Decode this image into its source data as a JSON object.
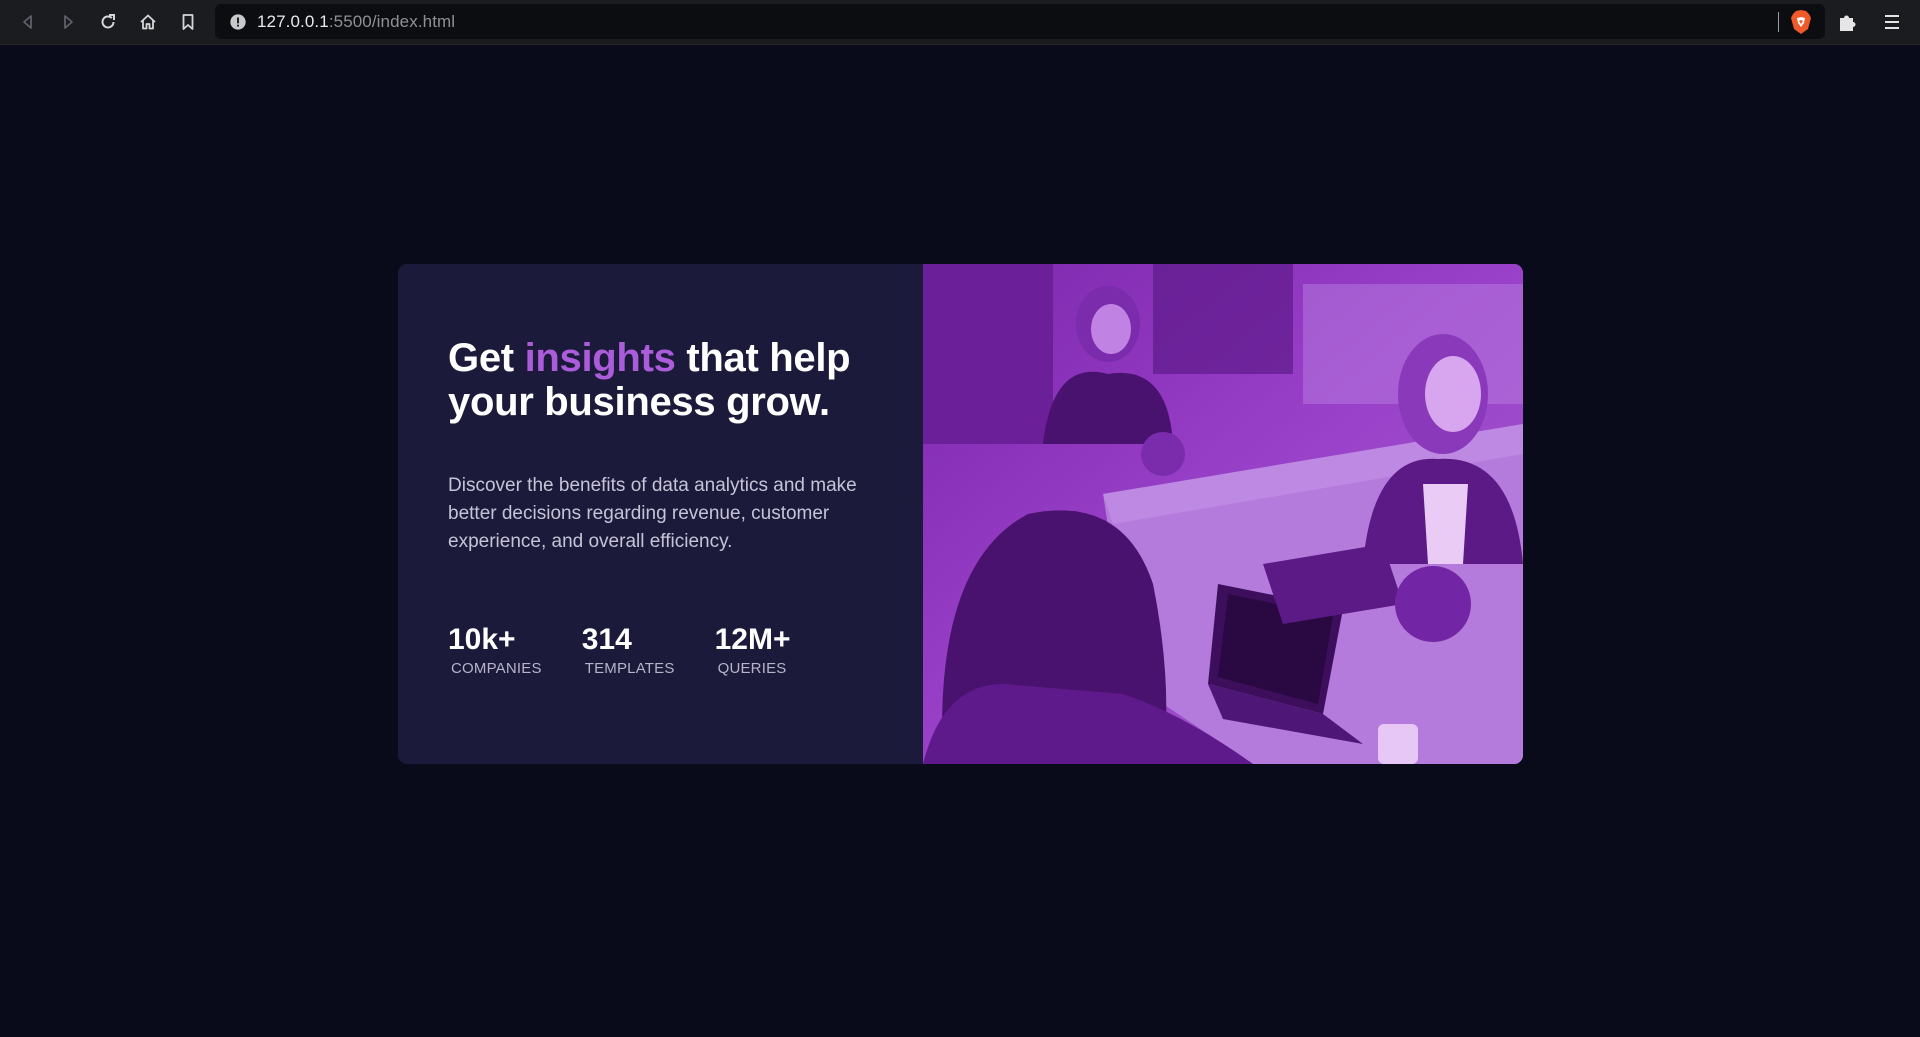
{
  "browser": {
    "url_host": "127.0.0.1",
    "url_path": ":5500/index.html"
  },
  "card": {
    "headline_part1": "Get ",
    "headline_accent": "insights",
    "headline_part2": " that help your business grow.",
    "description": "Discover the benefits of data analytics and make better decisions regarding revenue, customer experience, and overall efficiency.",
    "stats": [
      {
        "value": "10k+",
        "label": "COMPANIES"
      },
      {
        "value": "314",
        "label": "TEMPLATES"
      },
      {
        "value": "12M+",
        "label": "QUERIES"
      }
    ],
    "image_icon": "office-meeting-photo",
    "accent_color": "#ab5cdb"
  }
}
